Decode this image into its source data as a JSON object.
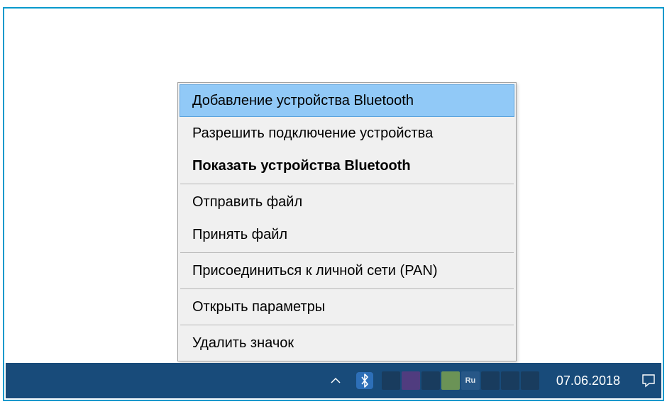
{
  "menu": {
    "items": [
      {
        "label": "Добавление устройства Bluetooth",
        "highlighted": true,
        "bold": false
      },
      {
        "label": "Разрешить подключение устройства",
        "highlighted": false,
        "bold": false
      },
      {
        "label": "Показать устройства Bluetooth",
        "highlighted": false,
        "bold": true
      }
    ],
    "group2": [
      {
        "label": "Отправить файл"
      },
      {
        "label": "Принять файл"
      }
    ],
    "group3": [
      {
        "label": "Присоединиться к личной сети (PAN)"
      }
    ],
    "group4": [
      {
        "label": "Открыть параметры"
      }
    ],
    "group5": [
      {
        "label": "Удалить значок"
      }
    ]
  },
  "taskbar": {
    "date": "07.06.2018",
    "lang": "Ru"
  },
  "icons": {
    "chevron_up": "chevron-up-icon",
    "bluetooth": "bluetooth-icon",
    "action_center": "action-center-icon"
  }
}
